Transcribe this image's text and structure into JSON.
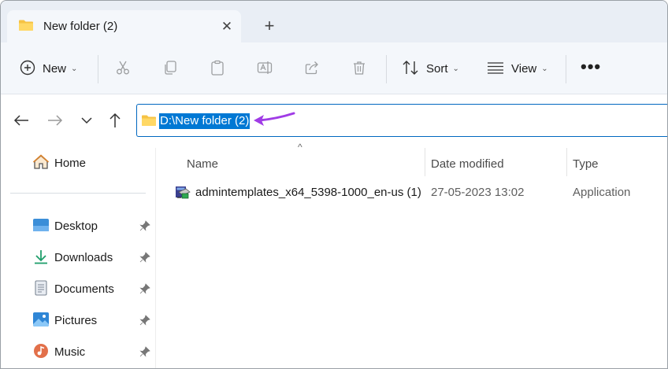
{
  "tab": {
    "title": "New folder (2)",
    "close_glyph": "✕",
    "new_tab_glyph": "+"
  },
  "toolbar": {
    "new_label": "New",
    "sort_label": "Sort",
    "view_label": "View",
    "more_glyph": "•••",
    "caret_glyph": "⌄"
  },
  "address": {
    "path": "D:\\New folder (2)"
  },
  "sidebar": {
    "items": [
      {
        "label": "Home",
        "icon": "home-icon"
      },
      {
        "label": "Desktop",
        "icon": "desktop-icon"
      },
      {
        "label": "Downloads",
        "icon": "downloads-icon"
      },
      {
        "label": "Documents",
        "icon": "documents-icon"
      },
      {
        "label": "Pictures",
        "icon": "pictures-icon"
      },
      {
        "label": "Music",
        "icon": "music-icon"
      }
    ]
  },
  "columns": {
    "name": "Name",
    "date": "Date modified",
    "type": "Type",
    "sort_caret": "^"
  },
  "files": [
    {
      "name": "admintemplates_x64_5398-1000_en-us (1)",
      "date": "27-05-2023 13:02",
      "type": "Application",
      "icon": "installer-icon"
    }
  ],
  "colors": {
    "accent": "#0078d4",
    "annotation_arrow": "#a03ce6",
    "folder": "#f6c344"
  }
}
